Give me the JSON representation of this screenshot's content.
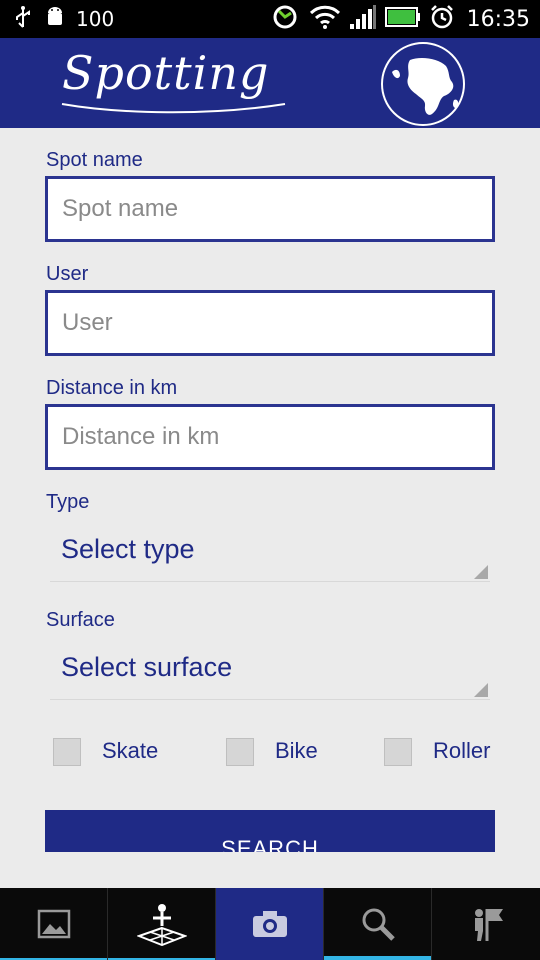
{
  "status_bar": {
    "battery_level": "100",
    "time": "16:35"
  },
  "header": {
    "app_name": "Spotting"
  },
  "form": {
    "spot_name": {
      "label": "Spot name",
      "placeholder": "Spot name",
      "value": ""
    },
    "user": {
      "label": "User",
      "placeholder": "User",
      "value": ""
    },
    "distance": {
      "label": "Distance in km",
      "placeholder": "Distance in km",
      "value": ""
    },
    "type": {
      "label": "Type",
      "selected": "Select type"
    },
    "surface": {
      "label": "Surface",
      "selected": "Select surface"
    },
    "checkboxes": [
      {
        "label": "Skate",
        "checked": false
      },
      {
        "label": "Bike",
        "checked": false
      },
      {
        "label": "Roller",
        "checked": false
      }
    ],
    "search_label": "SEARCH"
  },
  "bottom_nav": {
    "items": [
      {
        "icon": "gallery-icon",
        "active": false
      },
      {
        "icon": "map-pin-icon",
        "active": false
      },
      {
        "icon": "camera-icon",
        "active": true
      },
      {
        "icon": "search-icon",
        "active": false,
        "selected": true
      },
      {
        "icon": "skater-flag-icon",
        "active": false
      }
    ]
  },
  "colors": {
    "primary": "#1f2a86",
    "background": "#ebebeb",
    "accent": "#33b5e5"
  }
}
